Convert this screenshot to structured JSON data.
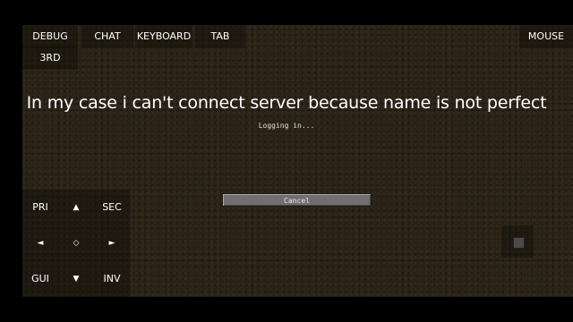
{
  "top_buttons": {
    "debug": "DEBUG",
    "chat": "CHAT",
    "keyboard": "KEYBOARD",
    "tab": "TAB",
    "mouse": "MOUSE",
    "third": "3RD"
  },
  "caption": "In my case i can't connect server because name is not perfect",
  "status_text": "Logging in...",
  "cancel_label": "Cancel",
  "dpad": {
    "pri": "PRI",
    "up": "▲",
    "sec": "SEC",
    "left": "◄",
    "center": "◇",
    "right": "►",
    "gui": "GUI",
    "down": "▼",
    "inv": "INV"
  },
  "colors": {
    "background": "#2b2418",
    "cancel_button": "#6f6f6f",
    "text": "#ffffff"
  }
}
